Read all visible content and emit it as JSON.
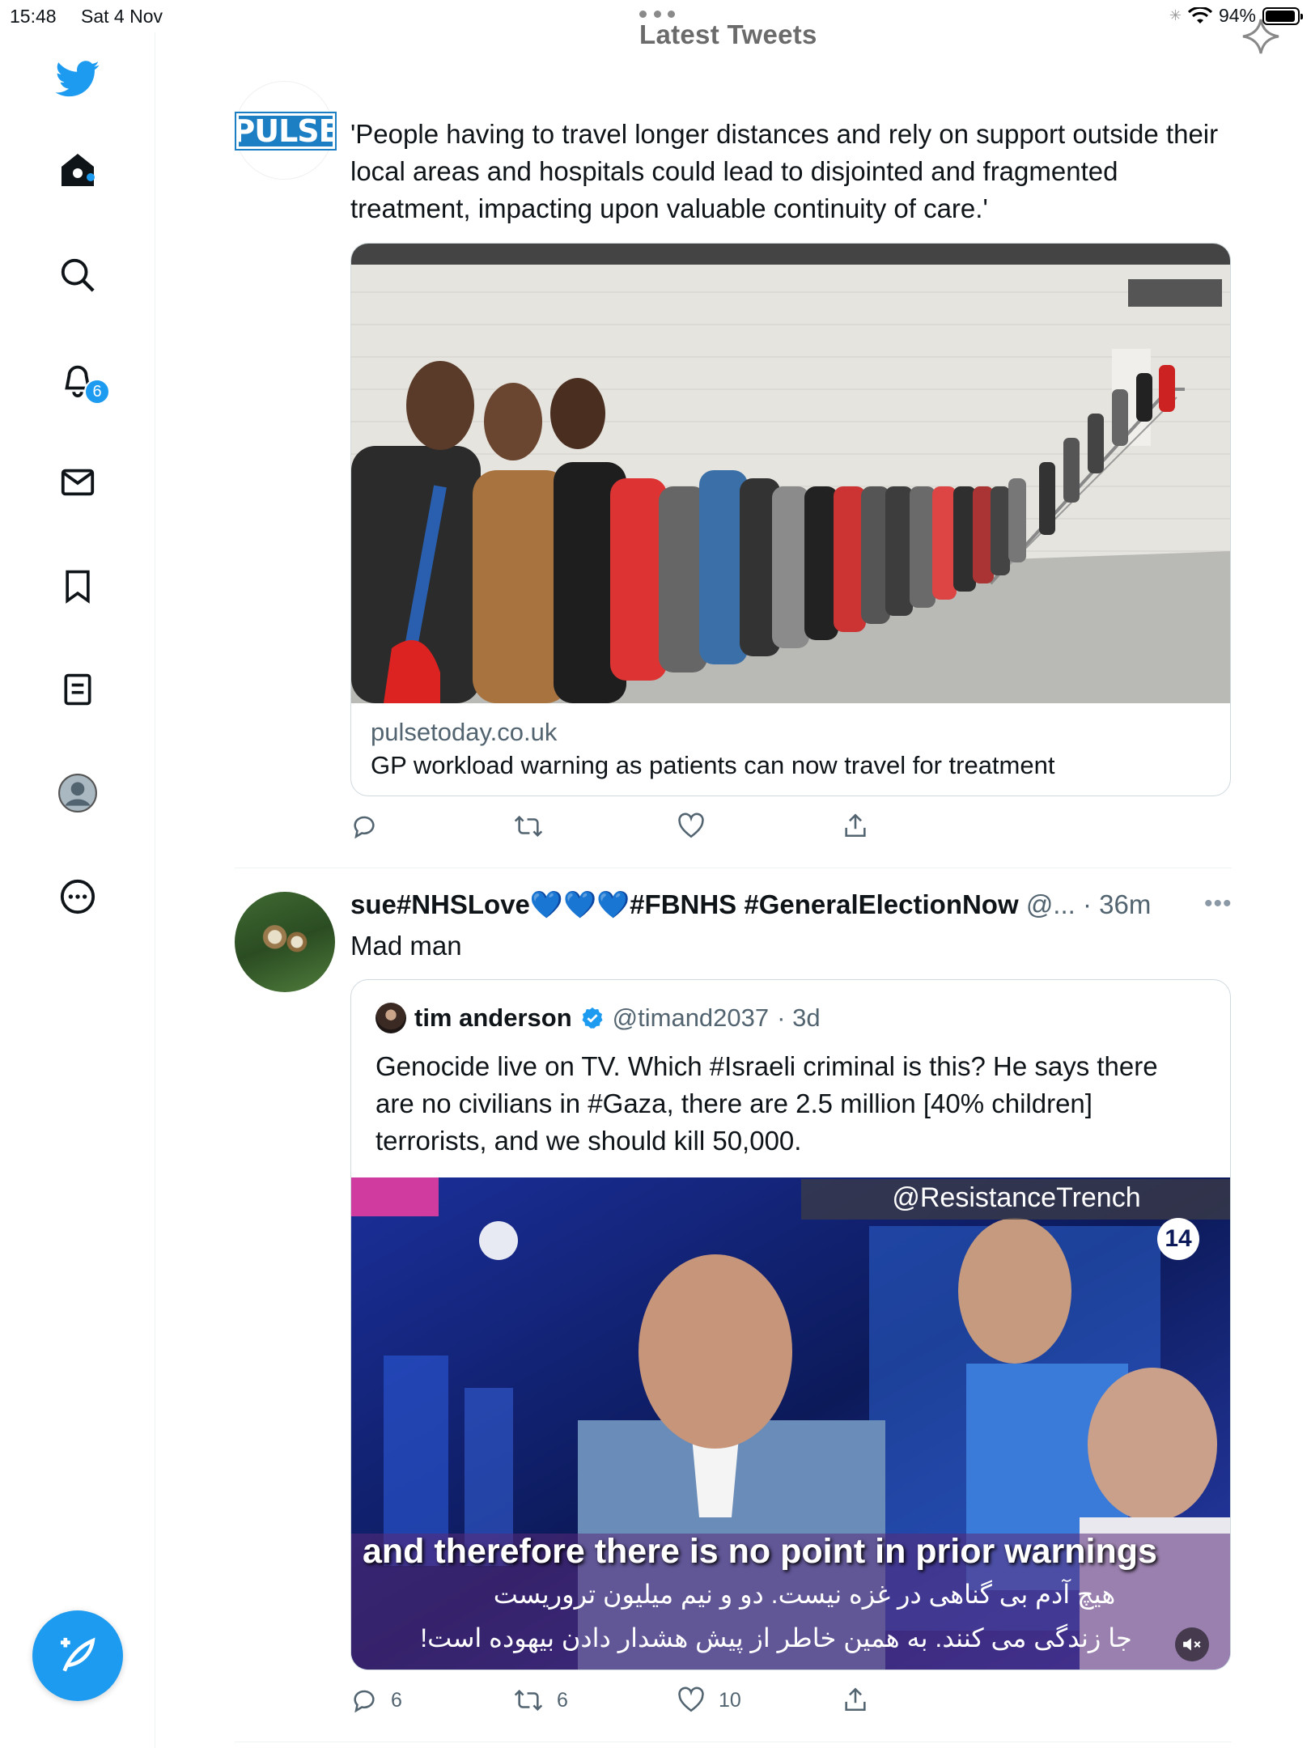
{
  "status_bar": {
    "time": "15:48",
    "date": "Sat 4 Nov",
    "battery": "94%",
    "battery_level": 0.94
  },
  "header": {
    "title": "Latest Tweets"
  },
  "sidebar": {
    "items": [
      {
        "name": "twitter-logo"
      },
      {
        "name": "home"
      },
      {
        "name": "search"
      },
      {
        "name": "notifications",
        "badge": "6"
      },
      {
        "name": "messages"
      },
      {
        "name": "bookmarks"
      },
      {
        "name": "lists"
      },
      {
        "name": "profile"
      },
      {
        "name": "more"
      }
    ]
  },
  "tweets": [
    {
      "author_logo": "PULSE",
      "text": "'People having to travel longer distances and rely on support outside their local areas and hospitals could lead to disjointed and fragmented treatment, impacting upon valuable continuity of care.'",
      "card": {
        "domain": "pulsetoday.co.uk",
        "title": "GP workload warning as patients can now travel for treatment"
      },
      "actions": {
        "replies": "",
        "retweets": "",
        "likes": ""
      }
    },
    {
      "name": "sue#NHSLove💙💙💙#FBNHS #GeneralElectionNow",
      "handle": "@...",
      "time": "· 36m",
      "text": "Mad man",
      "quote": {
        "name": "tim anderson",
        "handle": "@timand2037",
        "time": "· 3d",
        "text": "Genocide live on TV. Which #Israeli criminal is this? He says there are no civilians in #Gaza, there are 2.5 million [40% children] terrorists, and we should kill 50,000.",
        "video": {
          "watermark": "@ResistanceTrench",
          "channel": "14",
          "subtitle_en": "and therefore there is no point in prior warnings",
          "subtitle_fa_1": "هیچ آدم بی گناهی در غزه نیست. دو و نیم میلیون تروریست",
          "subtitle_fa_2": "جا زندگی می کنند. به همین خاطر از پیش هشدار دادن بیهوده است!"
        }
      },
      "actions": {
        "replies": "6",
        "retweets": "6",
        "likes": "10"
      }
    }
  ],
  "colors": {
    "accent": "#1d9bf0",
    "text": "#0f1419",
    "secondary": "#536471",
    "pulse": "#1c7fc4"
  }
}
